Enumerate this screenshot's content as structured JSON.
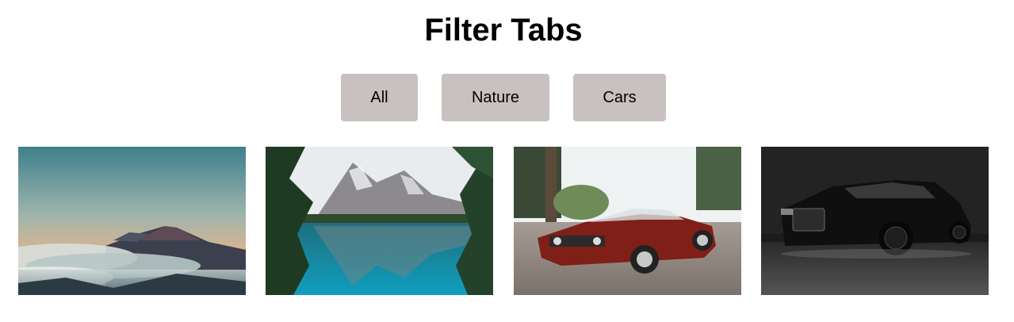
{
  "page": {
    "title": "Filter Tabs"
  },
  "tabs": [
    {
      "label": "All"
    },
    {
      "label": "Nature"
    },
    {
      "label": "Cars"
    }
  ],
  "gallery": {
    "items": [
      {
        "category": "nature",
        "subject": "volcano-above-clouds"
      },
      {
        "category": "nature",
        "subject": "mountain-lake-reflection"
      },
      {
        "category": "cars",
        "subject": "red-classic-convertible"
      },
      {
        "category": "cars",
        "subject": "black-luxury-sedan"
      }
    ]
  },
  "colors": {
    "tab_background": "#c9c0c0",
    "text": "#000000",
    "page_background": "#ffffff"
  }
}
